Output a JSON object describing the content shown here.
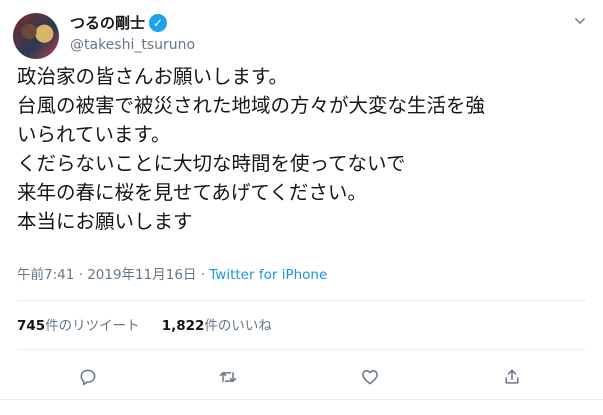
{
  "user": {
    "name": "つるの剛士",
    "handle": "@takeshi_tsuruno",
    "verified_icon": "verified-badge-icon"
  },
  "tweet": {
    "lines": [
      "政治家の皆さんお願いします。",
      "台風の被害で被災された地域の方々が大変な生活を強",
      "いられています。",
      "くだらないことに大切な時間を使ってないで",
      "来年の春に桜を見せてあげてください。",
      "本当にお願いします"
    ],
    "time": "午前7:41",
    "separator": " · ",
    "date": "2019年11月16日",
    "client": "Twitter for iPhone"
  },
  "stats": {
    "retweets_count": "745",
    "retweets_label": "件のリツイート",
    "likes_count": "1,822",
    "likes_label": "件のいいね"
  },
  "actions": [
    "reply-icon",
    "retweet-icon",
    "like-icon",
    "share-icon"
  ],
  "colors": {
    "text": "#14171a",
    "muted": "#657786",
    "link": "#1b95e0",
    "verified": "#1da1f2",
    "divider": "#e6ecf0"
  }
}
